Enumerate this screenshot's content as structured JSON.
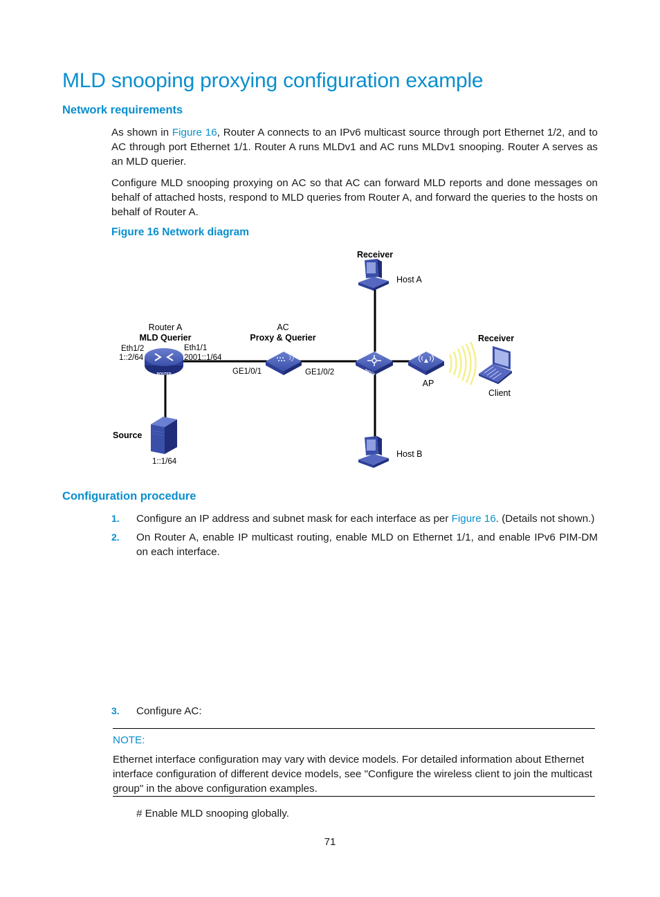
{
  "page": {
    "title": "MLD snooping proxying configuration example",
    "page_number": "71"
  },
  "network_requirements": {
    "heading": "Network requirements",
    "para1": {
      "before_link": "As shown in ",
      "link": "Figure 16",
      "after_link": ", Router A connects to an IPv6 multicast source through port Ethernet 1/2, and to AC through port Ethernet 1/1. Router A runs MLDv1 and AC runs MLDv1 snooping. Router A serves as an MLD querier."
    },
    "para2": "Configure MLD snooping proxying on AC so that AC can forward MLD reports and done messages on behalf of attached hosts, respond to MLD queries from Router A, and forward the queries to the hosts on behalf of Router A.",
    "figure_caption": "Figure 16 Network diagram"
  },
  "diagram": {
    "router": {
      "name": "Router A",
      "role": "MLD Querier",
      "port_left": "Eth1/2",
      "ip_left": "1::2/64",
      "port_right": "Eth1/1",
      "ip_right": "2001::1/64",
      "badge": "ROUTER"
    },
    "ac": {
      "name": "AC",
      "role": "Proxy & Querier",
      "port_left": "GE1/0/1",
      "port_right": "GE1/0/2"
    },
    "switch_badge": "SWITCH",
    "host_a": {
      "role": "Receiver",
      "name": "Host A"
    },
    "host_b": {
      "name": "Host B"
    },
    "ap": {
      "name": "AP"
    },
    "client": {
      "role": "Receiver",
      "name": "Client"
    },
    "source": {
      "name": "Source",
      "ip": "1::1/64"
    },
    "colors": {
      "device_blue": "#3a4fa8",
      "device_dark": "#1f2d7a",
      "wireless_yellow": "#f5f08a",
      "link_black": "#000000"
    }
  },
  "configuration_procedure": {
    "heading": "Configuration procedure",
    "steps": [
      {
        "num": "1.",
        "before_link": "Configure an IP address and subnet mask for each interface as per ",
        "link": "Figure 16",
        "after_link": ". (Details not shown.)"
      },
      {
        "num": "2.",
        "text": "On Router A, enable IP multicast routing, enable MLD on Ethernet 1/1, and enable IPv6 PIM-DM on each interface."
      },
      {
        "num": "3.",
        "text": "Configure AC:"
      }
    ],
    "note": {
      "label": "NOTE:",
      "text": "Ethernet interface configuration may vary with device models. For detailed information about Ethernet interface configuration of different device models, see \"Configure the wireless client to join the multicast group\" in the above configuration examples."
    },
    "command_comment": "# Enable MLD snooping globally."
  }
}
